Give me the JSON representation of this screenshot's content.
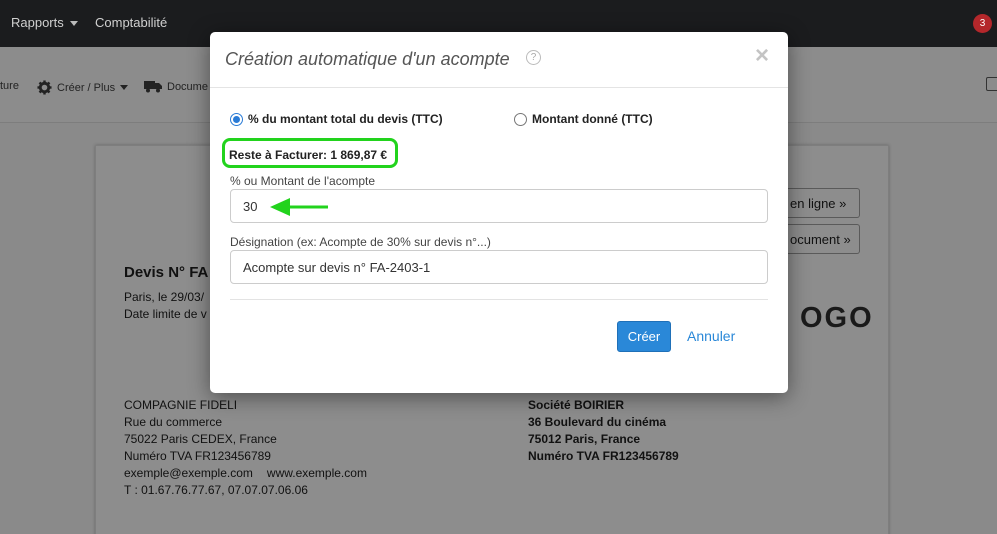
{
  "navbar": {
    "items": [
      {
        "label": "Rapports"
      },
      {
        "label": "Comptabilité"
      }
    ],
    "notification_count": "3"
  },
  "toolbar": {
    "facture_label": "ture",
    "creer_label": "Créer / Plus",
    "documents_label": "Docume"
  },
  "document": {
    "title": "Devis N° FA",
    "date_line": "Paris, le 29/03/",
    "limit_line": "Date limite de v",
    "side_buttons": [
      "en ligne »",
      "ocument »"
    ],
    "logo": "OGO",
    "sender": {
      "name": "COMPAGNIE FIDELI",
      "street": "Rue du commerce",
      "city": "75022 Paris CEDEX, France",
      "vat": "Numéro TVA FR123456789",
      "email": "exemple@exemple.com",
      "website": "www.exemple.com",
      "phone": "T : 01.67.76.77.67, 07.07.07.06.06"
    },
    "recipient": {
      "name": "Société BOIRIER",
      "street": "36 Boulevard du cinéma",
      "city": "75012 Paris, France",
      "vat": "Numéro TVA FR123456789"
    }
  },
  "modal": {
    "title": "Création automatique d'un acompte",
    "help_glyph": "?",
    "close_glyph": "×",
    "radio_percent_label": "% du montant total du devis (TTC)",
    "radio_amount_label": "Montant donné (TTC)",
    "selected_option": "percent",
    "reste_label": "Reste à Facturer: 1 869,87 €",
    "amount_label": "% ou Montant de l'acompte",
    "amount_value": "30",
    "designation_label": "Désignation (ex: Acompte de 30% sur devis n°...)",
    "designation_value": "Acompte sur devis n° FA-2403-1",
    "create_button": "Créer",
    "cancel_button": "Annuler"
  },
  "colors": {
    "accent": "#2a88d8",
    "highlight": "#22d31d",
    "badge": "#b4272b",
    "navbar": "#1b1c1e"
  },
  "icons": [
    "gear-icon",
    "truck-icon",
    "edit-icon",
    "help-icon",
    "close-icon",
    "arrow-left-icon"
  ]
}
